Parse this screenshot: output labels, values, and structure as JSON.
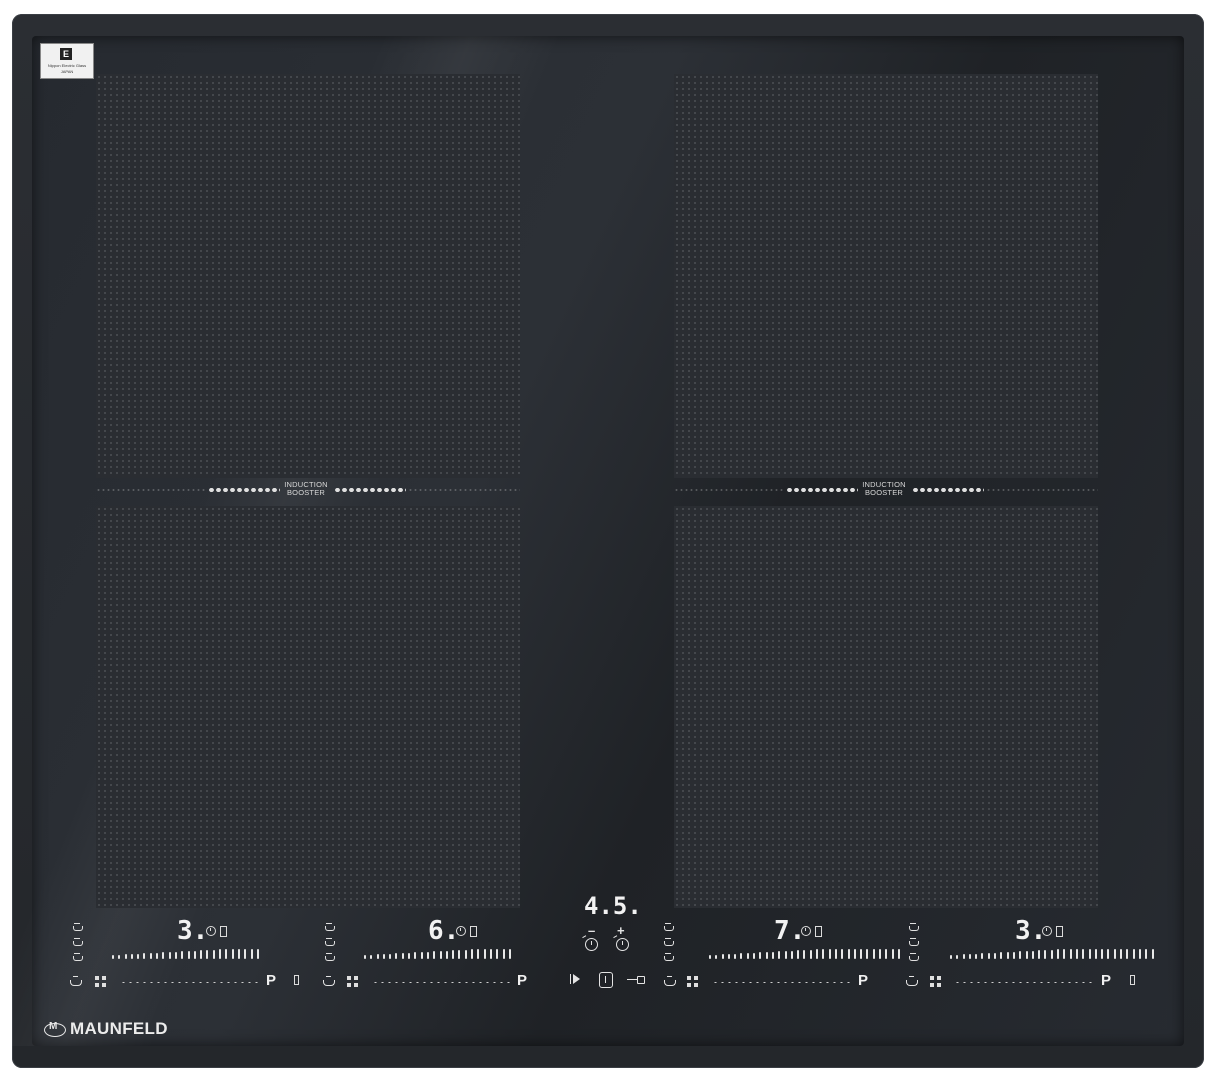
{
  "certificate": {
    "line1": "Nippon Electric Glass",
    "line2": "JAPAN"
  },
  "zones": {
    "left": {
      "booster_label_1": "INDUCTION",
      "booster_label_2": "BOOSTER"
    },
    "right": {
      "booster_label_1": "INDUCTION",
      "booster_label_2": "BOOSTER"
    }
  },
  "controls": {
    "zone1": {
      "level": "3.",
      "p_label": "P"
    },
    "zone2": {
      "level": "6.",
      "p_label": "P"
    },
    "zone3": {
      "level": "7.",
      "p_label": "P"
    },
    "zone4": {
      "level": "3.",
      "p_label": "P"
    },
    "timer": {
      "display": "4.5.",
      "minus": "–",
      "plus": "+"
    }
  },
  "brand": {
    "name": "MAUNFELD"
  },
  "colors": {
    "glass": "#24272b",
    "display": "#f2f2f2"
  }
}
